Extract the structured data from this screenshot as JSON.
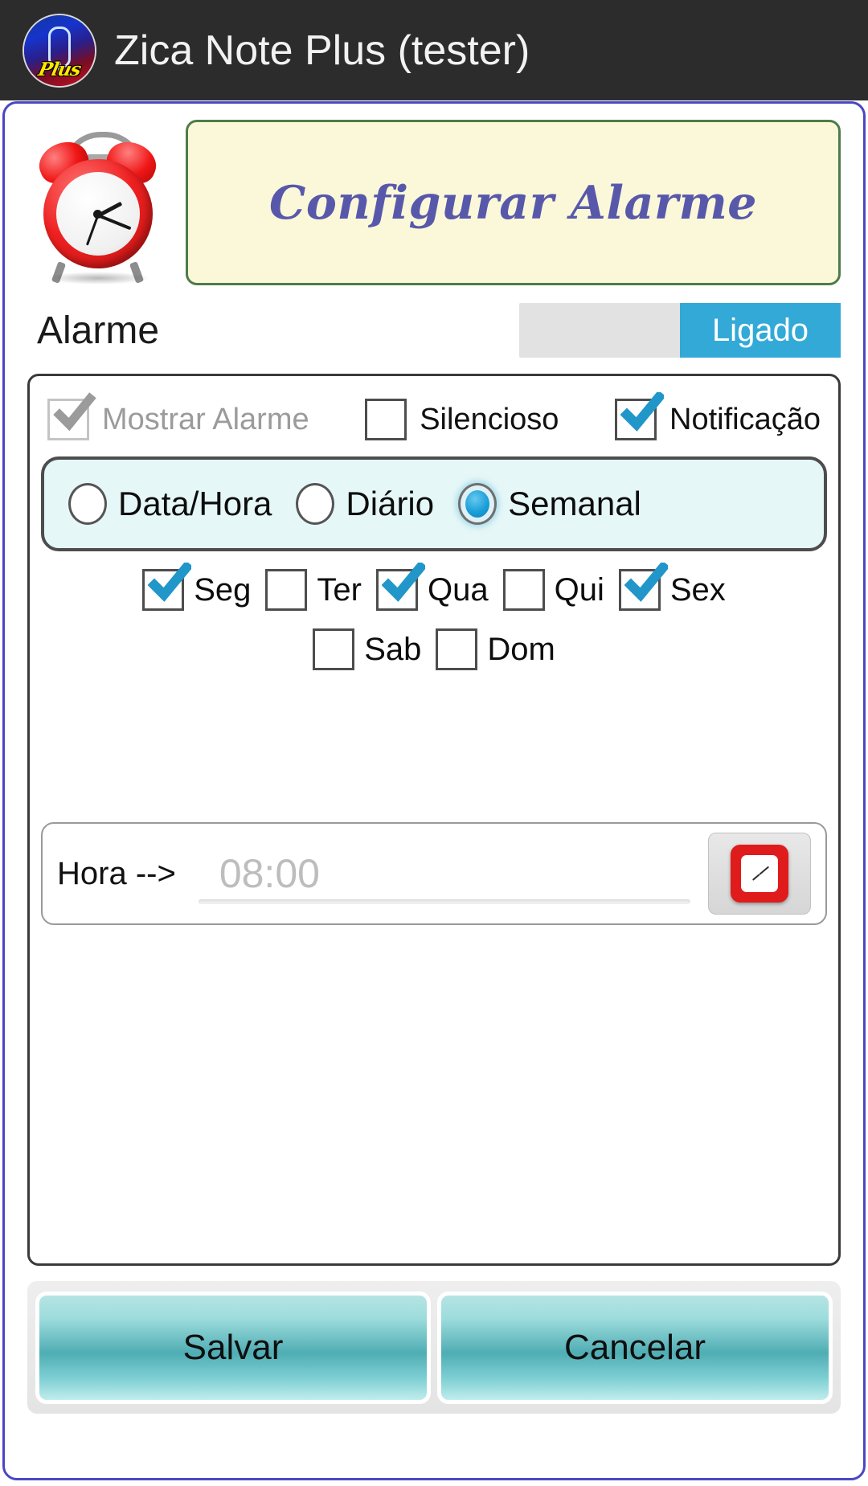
{
  "titlebar": {
    "app_title": "Zica Note Plus (tester)",
    "logo_word": "Plus"
  },
  "header": {
    "banner_title": "Configurar Alarme",
    "clock_icon": "alarm-clock-icon"
  },
  "alarm_switch": {
    "label": "Alarme",
    "state_label": "Ligado",
    "on_color": "#33a9d8",
    "track_color": "#e2e2e2"
  },
  "options": [
    {
      "label": "Mostrar Alarme",
      "checked": true,
      "disabled": true
    },
    {
      "label": "Silencioso",
      "checked": false,
      "disabled": false
    },
    {
      "label": "Notificação",
      "checked": true,
      "disabled": false
    }
  ],
  "repeat_modes": [
    {
      "label": "Data/Hora",
      "selected": false
    },
    {
      "label": "Diário",
      "selected": false
    },
    {
      "label": "Semanal",
      "selected": true
    }
  ],
  "weekdays_row1": [
    {
      "label": "Seg",
      "checked": true
    },
    {
      "label": "Ter",
      "checked": false
    },
    {
      "label": "Qua",
      "checked": true
    },
    {
      "label": "Qui",
      "checked": false
    },
    {
      "label": "Sex",
      "checked": true
    }
  ],
  "weekdays_row2": [
    {
      "label": "Sab",
      "checked": false
    },
    {
      "label": "Dom",
      "checked": false
    }
  ],
  "time": {
    "label": "Hora  -->",
    "value": "08:00",
    "placeholder": "08:00",
    "picker_icon": "clock-picker-icon"
  },
  "footer": {
    "save_label": "Salvar",
    "cancel_label": "Cancelar"
  },
  "colors": {
    "accent_blue": "#33a9d8",
    "banner_bg": "#fbf8da",
    "banner_border": "#4d7c48",
    "banner_text": "#5858ab",
    "screen_border": "#4a47c4",
    "radio_strip_bg": "#e6f7f7",
    "button_teal": "#4fadb4"
  }
}
